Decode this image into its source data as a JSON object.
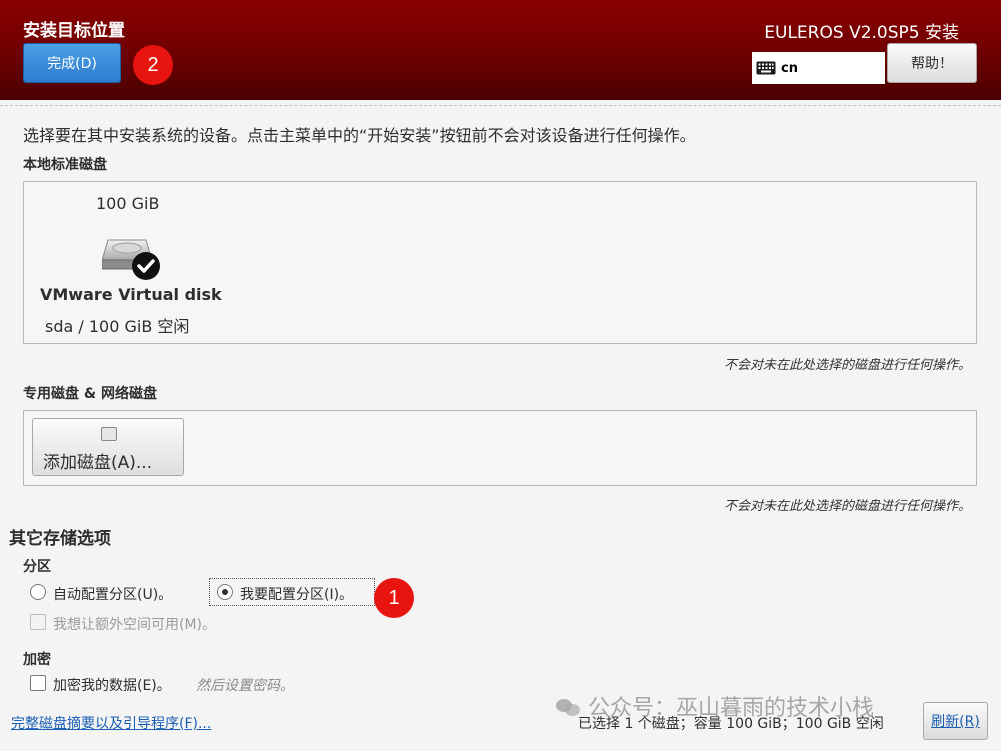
{
  "header": {
    "title": "安装目标位置",
    "done_button": "完成(D)",
    "product": "EULEROS V2.0SP5 安装",
    "keyboard_layout": "cn",
    "help_button": "帮助！"
  },
  "badges": {
    "first": "1",
    "second": "2"
  },
  "instruction": "选择要在其中安装系统的设备。点击主菜单中的“开始安装”按钮前不会对该设备进行任何操作。",
  "local_disks": {
    "label": "本地标准磁盘",
    "disk": {
      "size": "100 GiB",
      "name": "VMware Virtual disk",
      "free": "sda  /  100 GiB 空闲",
      "selected": true
    },
    "note": "不会对未在此处选择的磁盘进行任何操作。"
  },
  "special_disks": {
    "label": "专用磁盘 & 网络磁盘",
    "add_button": "添加磁盘(A)...",
    "note": "不会对未在此处选择的磁盘进行任何操作。"
  },
  "other_storage": {
    "label": "其它存储选项",
    "partitioning": {
      "label": "分区",
      "auto": "自动配置分区(U)。",
      "manual": "我要配置分区(I)。",
      "selected": "manual",
      "extra_space": "我想让额外空间可用(M)。"
    },
    "encryption": {
      "label": "加密",
      "encrypt": "加密我的数据(E)。",
      "hint": "然后设置密码。"
    }
  },
  "footer": {
    "summary_link": "完整磁盘摘要以及引导程序(F)...",
    "status": "已选择 1 个磁盘；容量 100 GiB；100 GiB 空闲",
    "refresh_button": "刷新(R)"
  },
  "watermark": "公众号：巫山暮雨的技术小栈",
  "colors": {
    "header": "#7a0000",
    "primary_button": "#3a8ad8",
    "badge": "#e8140f",
    "link": "#1a5fb4"
  }
}
